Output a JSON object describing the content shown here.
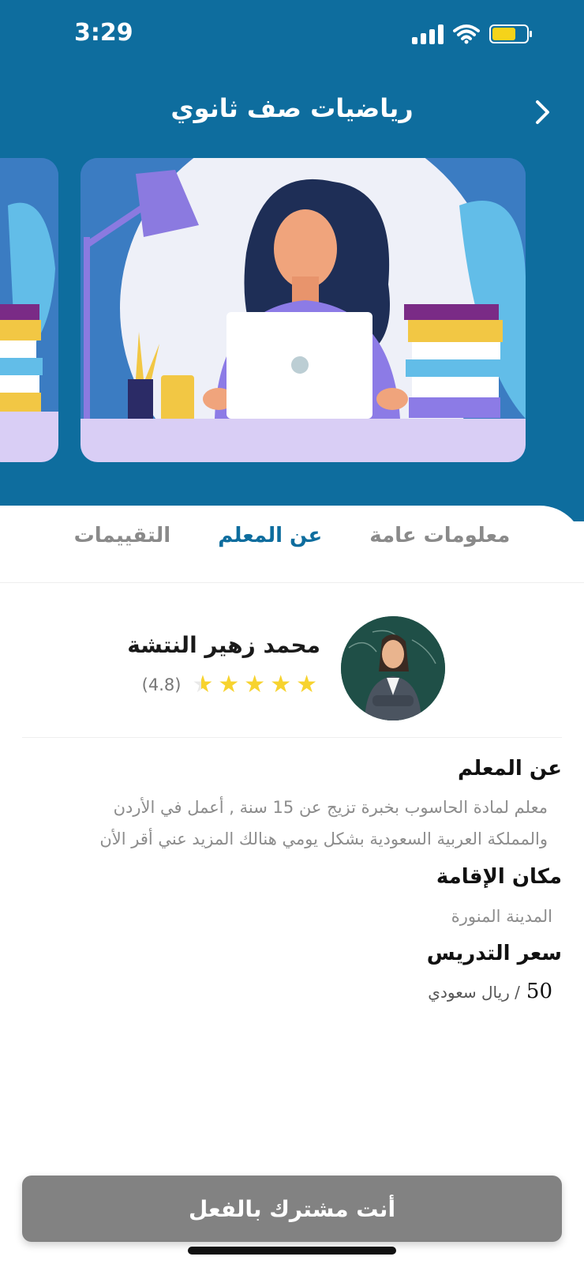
{
  "status_bar": {
    "time": "3:29",
    "icons": [
      "cellular-signal-icon",
      "wifi-icon",
      "battery-icon"
    ],
    "battery_color": "#F5D31A"
  },
  "header": {
    "title": "رياضيات صف ثانوي",
    "back_icon": "chevron-right-icon",
    "background_color": "#0E6D9E"
  },
  "carousel": {
    "main_illustration": "teacher-at-laptop-illustration",
    "peek_illustration": "books-illustration"
  },
  "tabs": [
    {
      "label": "معلومات عامة",
      "active": false
    },
    {
      "label": "عن المعلم",
      "active": true
    },
    {
      "label": "التقييمات",
      "active": false
    }
  ],
  "teacher": {
    "name": "محمد زهير النتشة",
    "rating_text": "(4.8)",
    "rating_value": 4.8,
    "rating_max": 5
  },
  "sections": {
    "about": {
      "title": "عن المعلم",
      "line1": "معلم لمادة الحاسوب بخبرة تزيج عن 15 سنة , أعمل في الأردن",
      "line2": "والمملكة العربية السعودية بشكل يومي هنالك المزيد عني أقر الأن"
    },
    "residence": {
      "title": "مكان الإقامة",
      "value": "المدينة المنورة"
    },
    "price": {
      "title": "سعر التدريس",
      "amount": "50",
      "unit": "/ ريال سعودي"
    }
  },
  "button": {
    "label": "أنت مشترك بالفعل",
    "color": "#828282"
  },
  "accent_color": "#0E6D9E",
  "star_color": "#F7D32F"
}
